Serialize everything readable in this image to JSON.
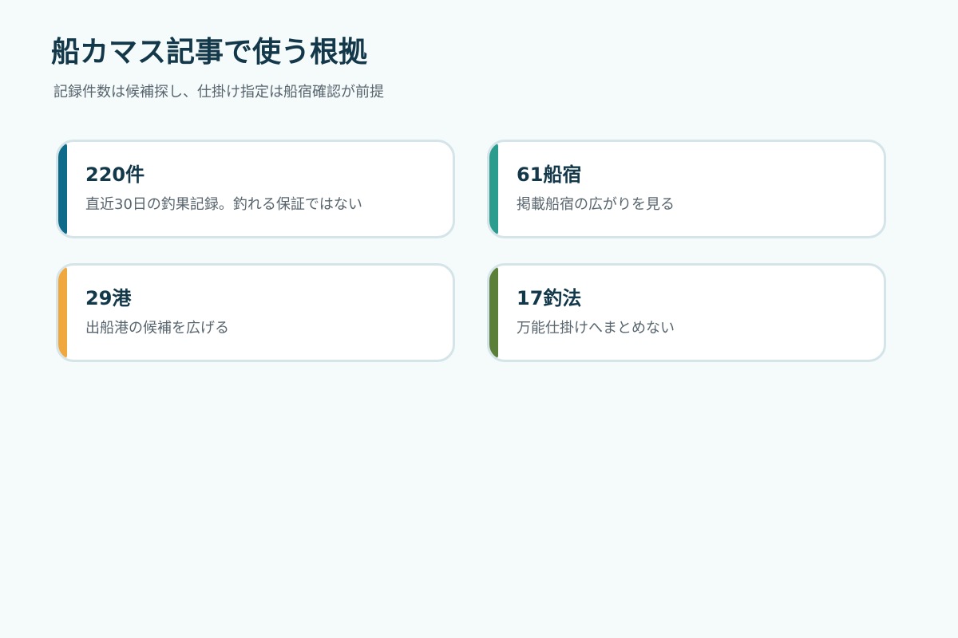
{
  "header": {
    "title": "船カマス記事で使う根拠",
    "subtitle": "記録件数は候補探し、仕掛け指定は船宿確認が前提"
  },
  "cards": [
    {
      "value": "220件",
      "note": "直近30日の釣果記録。釣れる保証ではない",
      "accent": "#0f6b8a"
    },
    {
      "value": "61船宿",
      "note": "掲載船宿の広がりを見る",
      "accent": "#2a9d8f"
    },
    {
      "value": "29港",
      "note": "出船港の候補を広げる",
      "accent": "#f0a83e"
    },
    {
      "value": "17釣法",
      "note": "万能仕掛けへまとめない",
      "accent": "#5b7f38"
    }
  ],
  "colors": {
    "background": "#f5fafb",
    "card_border": "#d4e4e9",
    "title_text": "#12384a",
    "body_text": "#58656e"
  }
}
